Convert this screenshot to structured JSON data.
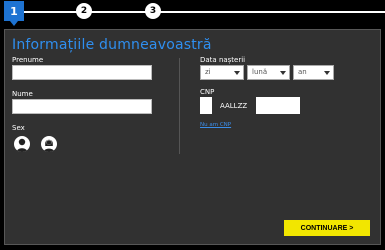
{
  "stepper": {
    "steps": [
      {
        "number": "1",
        "state": "active"
      },
      {
        "number": "2",
        "state": "pending"
      },
      {
        "number": "3",
        "state": "pending"
      }
    ],
    "active_color": "#1e73d2"
  },
  "form": {
    "title": "Informațiile dumneavoastră",
    "first_name_label": "Prenume",
    "first_name_value": "",
    "last_name_label": "Nume",
    "last_name_value": "",
    "sex_label": "Sex",
    "sex_options": [
      "male-icon",
      "female-icon"
    ],
    "birth_date_label": "Data nașterii",
    "birth_day": "zi",
    "birth_month": "lună",
    "birth_year": "an",
    "cnp_label": "CNP",
    "cnp_prefix_value": "",
    "cnp_middle_text": "AALLZZ",
    "cnp_suffix_value": "",
    "no_cnp_link": "Nu am CNP",
    "continue_label": "CONTINUARE >"
  },
  "colors": {
    "title": "#2f8ff0",
    "panel_bg": "#313131",
    "button_bg": "#f2e600",
    "link": "#3b8eea"
  }
}
